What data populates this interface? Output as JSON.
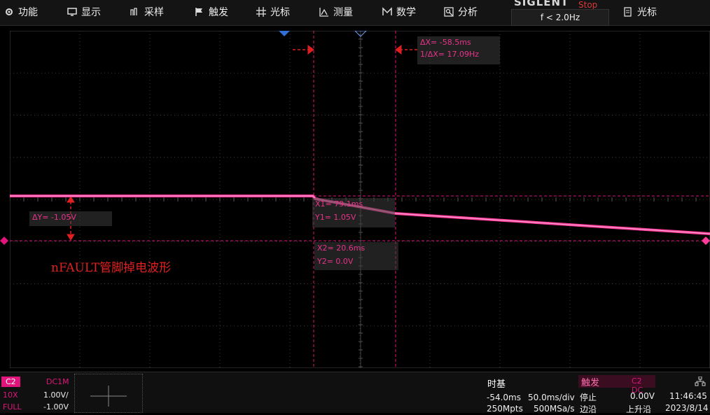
{
  "menu": {
    "items": [
      {
        "label": "功能",
        "icon": "gear-icon"
      },
      {
        "label": "显示",
        "icon": "monitor-icon"
      },
      {
        "label": "采样",
        "icon": "sample-icon"
      },
      {
        "label": "触发",
        "icon": "flag-icon"
      },
      {
        "label": "光标",
        "icon": "crosshair-icon"
      },
      {
        "label": "测量",
        "icon": "measure-icon"
      },
      {
        "label": "数学",
        "icon": "math-icon"
      },
      {
        "label": "分析",
        "icon": "analysis-icon"
      }
    ],
    "brand": "SIGLENT",
    "run_status": "Stop",
    "trigger_freq": "f < 2.0Hz",
    "cursor_item": {
      "label": "光标",
      "icon": "document-icon"
    }
  },
  "cursors": {
    "delta_x": "ΔX= -58.5ms",
    "inv_delta_x": "1/ΔX= 17.09Hz",
    "delta_y": "ΔY= -1.05V",
    "x1": "X1= 79.1ms",
    "y1": "Y1= 1.05V",
    "x2": "X2= 20.6ms",
    "y2": "Y2= 0.0V"
  },
  "annotation": "nFAULT管脚掉电波形",
  "colors": {
    "trace": "#ff3c9c",
    "cursor": "#e0157c",
    "marker": "#e02020",
    "trigger_marker": "#2f6fd6"
  },
  "channel": {
    "tag": "C2",
    "coupling": "DC1M",
    "probe": "10X",
    "scale": "1.00V/",
    "bandwidth": "FULL",
    "offset": "-1.00V"
  },
  "timebase": {
    "title": "时基",
    "delay": "-54.0ms",
    "scale": "50.0ms/div",
    "depth": "250Mpts",
    "rate": "500MSa/s"
  },
  "trigger": {
    "title": "触发",
    "source": "C2 DC",
    "mode": "停止",
    "level": "0.00V",
    "type": "边沿",
    "slope": "上升沿"
  },
  "clock": {
    "time": "11:46:45",
    "date": "2023/8/14"
  }
}
